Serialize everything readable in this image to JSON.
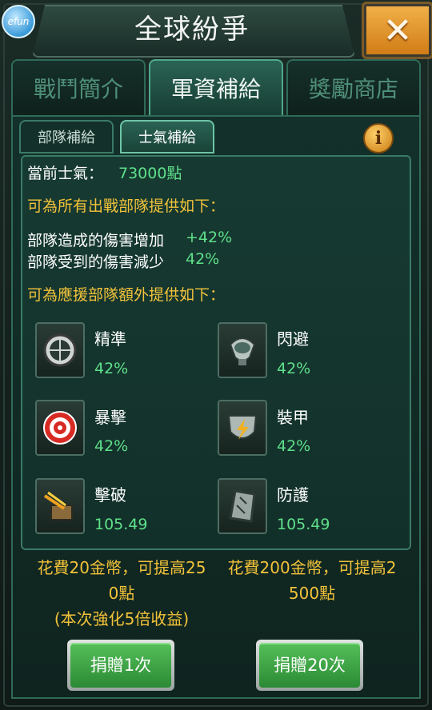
{
  "window": {
    "title": "全球紛爭",
    "logo_text": "efun"
  },
  "tabs": [
    {
      "label": "戰鬥簡介"
    },
    {
      "label": "軍資補給"
    },
    {
      "label": "獎勵商店"
    }
  ],
  "subtabs": [
    {
      "label": "部隊補給"
    },
    {
      "label": "士氣補給"
    }
  ],
  "morale": {
    "label": "當前士氣：",
    "value": "73000點"
  },
  "all_units": {
    "heading": "可為所有出戰部隊提供如下：",
    "damage_dealt_label": "部隊造成的傷害增加",
    "damage_dealt_value": "+42%",
    "damage_taken_label": "部隊受到的傷害減少",
    "damage_taken_value": "42%"
  },
  "support_units": {
    "heading": "可為應援部隊額外提供如下：",
    "bonuses": [
      {
        "name": "精準",
        "value": "42%",
        "icon": "scope-icon"
      },
      {
        "name": "閃避",
        "value": "42%",
        "icon": "radar-icon"
      },
      {
        "name": "暴擊",
        "value": "42%",
        "icon": "target-icon"
      },
      {
        "name": "裝甲",
        "value": "42%",
        "icon": "shield-icon"
      },
      {
        "name": "擊破",
        "value": "105.49",
        "icon": "turret-icon"
      },
      {
        "name": "防護",
        "value": "105.49",
        "icon": "armor-plate-icon"
      }
    ]
  },
  "costs": {
    "single_line1": "花費20金幣，可提高25",
    "single_line2": "0點",
    "single_line3": "(本次強化5倍收益)",
    "multi_line1": "花費200金幣，可提高2",
    "multi_line2": "500點"
  },
  "buttons": {
    "donate_once": "捐贈1次",
    "donate_twenty": "捐贈20次"
  },
  "colors": {
    "accent_green": "#5fe08a",
    "heading_yellow": "#f2c23a",
    "button_green": "#2b8a34",
    "close_orange": "#e0962a"
  }
}
